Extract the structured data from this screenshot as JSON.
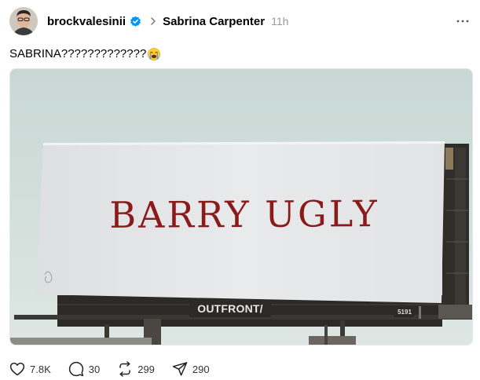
{
  "post": {
    "author": "brockvalesinii",
    "community": "Sabrina Carpenter",
    "time": "11h",
    "text": "SABRINA?????????????",
    "emoji": "loudly-crying-face-emoji"
  },
  "media": {
    "billboard_text": "BARRY UGLY",
    "operator_logo": "OUTFRONT/",
    "panel_number": "5191"
  },
  "actions": {
    "likes": "7.8K",
    "replies": "30",
    "reposts": "299",
    "shares": "290"
  },
  "colors": {
    "verified": "#0095f6",
    "billboard_text": "#8b1a1a",
    "sky": "#cfdcd9"
  }
}
